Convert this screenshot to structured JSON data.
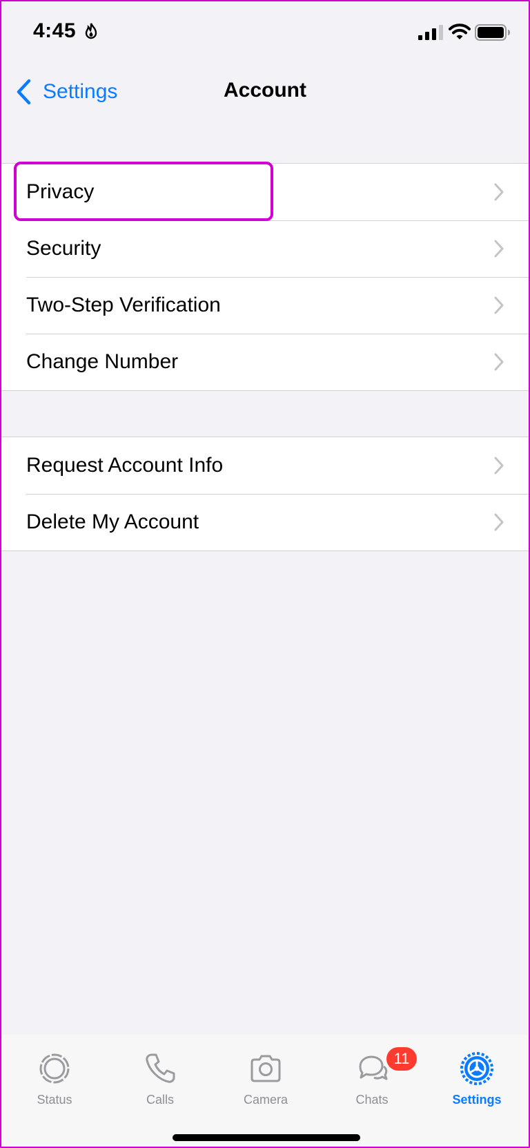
{
  "status_bar": {
    "time": "4:45"
  },
  "nav": {
    "back_label": "Settings",
    "title": "Account"
  },
  "group1": [
    {
      "label": "Privacy"
    },
    {
      "label": "Security"
    },
    {
      "label": "Two-Step Verification"
    },
    {
      "label": "Change Number"
    }
  ],
  "group2": [
    {
      "label": "Request Account Info"
    },
    {
      "label": "Delete My Account"
    }
  ],
  "tabs": [
    {
      "label": "Status",
      "icon": "status-icon"
    },
    {
      "label": "Calls",
      "icon": "phone-icon"
    },
    {
      "label": "Camera",
      "icon": "camera-icon"
    },
    {
      "label": "Chats",
      "icon": "chat-bubbles-icon",
      "badge": "11"
    },
    {
      "label": "Settings",
      "icon": "gear-icon",
      "active": true
    }
  ],
  "colors": {
    "accent": "#0a7cff",
    "highlight": "#d100d1",
    "badge": "#ff3b30",
    "background": "#f2f2f7"
  }
}
